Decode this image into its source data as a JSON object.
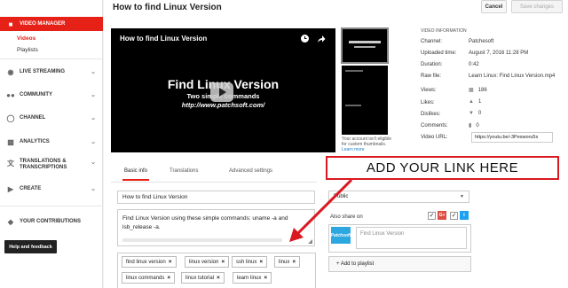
{
  "sidebar": {
    "video_manager": "VIDEO MANAGER",
    "videos": "Videos",
    "playlists": "Playlists",
    "live_streaming": "LIVE STREAMING",
    "community": "COMMUNITY",
    "channel": "CHANNEL",
    "analytics": "ANALYTICS",
    "translations_1": "TRANSLATIONS &",
    "translations_2": "TRANSCRIPTIONS",
    "create": "CREATE",
    "contributions": "YOUR CONTRIBUTIONS",
    "help": "Help and feedback"
  },
  "header": {
    "title": "How to find Linux Version",
    "cancel": "Cancel",
    "save": "Save changes"
  },
  "player": {
    "title": "How to find Linux Version",
    "big_text": "Find Linux Version",
    "sub_text": "Two simple commands",
    "url_text": "http://www.patchsoft.com/"
  },
  "thumbnails": {
    "note": "Your account isn't eligible for custom thumbnails.",
    "learn_more": "Learn more"
  },
  "video_info": {
    "heading": "VIDEO INFORMATION",
    "channel_label": "Channel:",
    "channel": "Patchesoft",
    "uploaded_label": "Uploaded time:",
    "uploaded": "August 7, 2016 11:28 PM",
    "duration_label": "Duration:",
    "duration": "0:42",
    "raw_label": "Raw file:",
    "raw": "Learn Linux: Find Linux Version.mp4",
    "views_label": "Views:",
    "views": "186",
    "likes_label": "Likes:",
    "likes": "1",
    "dislikes_label": "Dislikes:",
    "dislikes": "0",
    "comments_label": "Comments:",
    "comments": "0",
    "url_label": "Video URL:",
    "url": "https://youtu.be/-3Pesworu5s"
  },
  "tabs": {
    "basic": "Basic info",
    "translations": "Translations",
    "advanced": "Advanced settings"
  },
  "form": {
    "title_value": "How to find Linux Version",
    "desc_line1": "Find Linux Version using these simple commands: uname -a and",
    "desc_line2": "lsb_release -a.",
    "tags": [
      "find linux version",
      "linux version",
      "ssh linux",
      "linux",
      "linux commands",
      "linux tutorial",
      "learn linux"
    ]
  },
  "right_panel": {
    "privacy": "Public",
    "share_label": "Also share on",
    "share_placeholder": "Find Linux Version",
    "avatar_text": "Patchsoft",
    "add_playlist": "+ Add to playlist",
    "google_plus": "G+",
    "twitter": "t"
  },
  "callout": {
    "text": "ADD YOUR LINK HERE",
    "color": "#d91820"
  }
}
